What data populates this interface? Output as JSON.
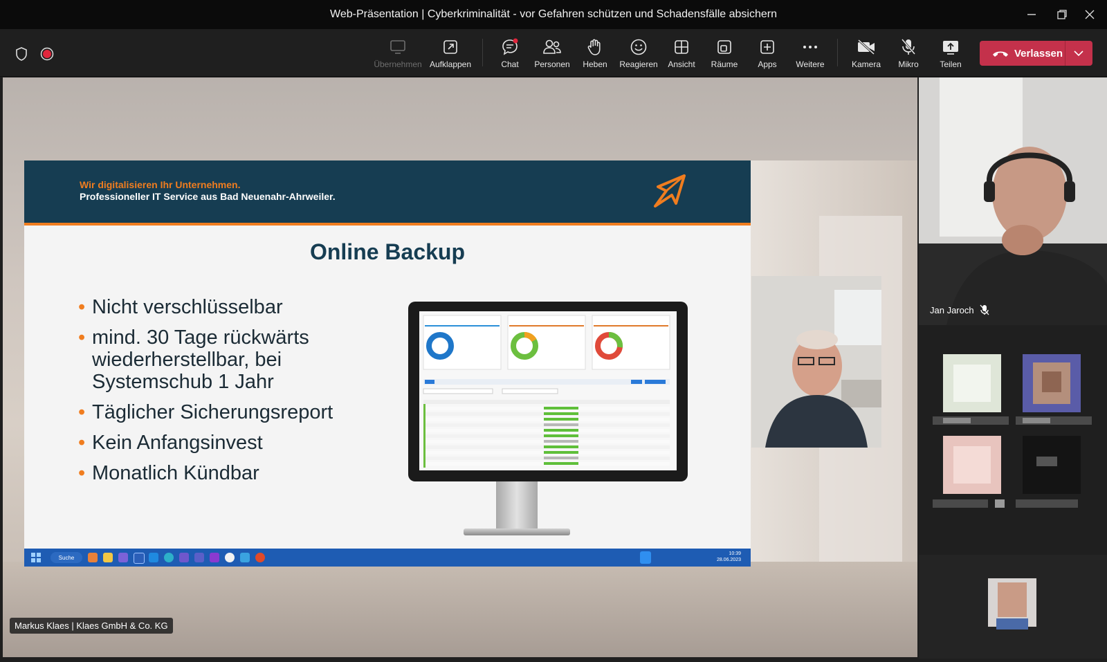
{
  "window": {
    "title": "Web-Präsentation | Cyberkriminalität - vor Gefahren schützen und Schadensfälle absichern"
  },
  "toolbar": {
    "buttons": [
      {
        "label": "Übernehmen",
        "icon": "share-screen-icon",
        "disabled": true
      },
      {
        "label": "Aufklappen",
        "icon": "popout-icon"
      },
      {
        "label": "Chat",
        "icon": "chat-icon"
      },
      {
        "label": "Personen",
        "icon": "people-icon"
      },
      {
        "label": "Heben",
        "icon": "raise-hand-icon"
      },
      {
        "label": "Reagieren",
        "icon": "smiley-icon"
      },
      {
        "label": "Ansicht",
        "icon": "grid-icon"
      },
      {
        "label": "Räume",
        "icon": "rooms-icon"
      },
      {
        "label": "Apps",
        "icon": "apps-icon"
      },
      {
        "label": "Weitere",
        "icon": "more-icon"
      },
      {
        "label": "Kamera",
        "icon": "camera-off-icon"
      },
      {
        "label": "Mikro",
        "icon": "mic-off-icon"
      },
      {
        "label": "Teilen",
        "icon": "share-icon"
      }
    ],
    "leave_label": "Verlassen",
    "leave_color": "#c4314b"
  },
  "slide": {
    "tagline1": "Wir digitalisieren Ihr Unternehmen.",
    "tagline2": "Professioneller IT Service aus Bad Neuenahr-Ahrweiler.",
    "title": "Online Backup",
    "bullets": [
      "Nicht verschlüsselbar",
      "mind. 30 Tage rückwärts wiederherstellbar, bei Systemschub 1 Jahr",
      "Täglicher Sicherungsreport",
      "Kein Anfangsinvest",
      "Monatlich Kündbar"
    ],
    "accent_color": "#f07d1f",
    "header_color": "#163d52",
    "taskbar": {
      "search_label": "Suche",
      "time": "10:39",
      "date": "28.06.2023"
    }
  },
  "presenter_label": "Markus Klaes | Klaes GmbH & Co. KG",
  "participants": {
    "main_name": "Jan Jaroch"
  }
}
